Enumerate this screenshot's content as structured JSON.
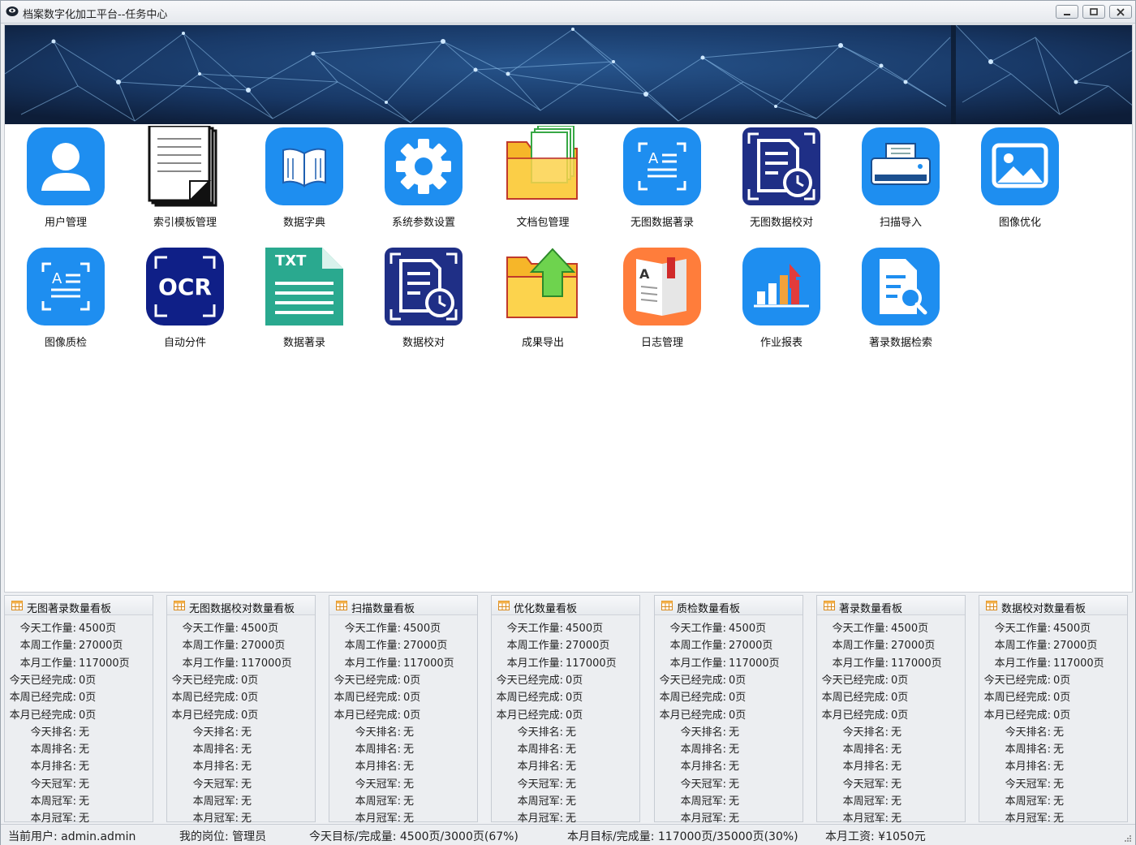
{
  "window": {
    "title": "档案数字化加工平台--任务中心"
  },
  "modules": [
    {
      "label": "用户管理",
      "icon": "user-icon"
    },
    {
      "label": "索引模板管理",
      "icon": "document-stack-icon"
    },
    {
      "label": "数据字典",
      "icon": "book-icon"
    },
    {
      "label": "系统参数设置",
      "icon": "gear-icon"
    },
    {
      "label": "文档包管理",
      "icon": "folder-documents-icon"
    },
    {
      "label": "无图数据著录",
      "icon": "text-scan-icon"
    },
    {
      "label": "无图数据校对",
      "icon": "document-clock-icon"
    },
    {
      "label": "扫描导入",
      "icon": "scanner-icon"
    },
    {
      "label": "图像优化",
      "icon": "image-icon"
    },
    {
      "label": "图像质检",
      "icon": "text-scan-icon"
    },
    {
      "label": "自动分件",
      "icon": "ocr-icon"
    },
    {
      "label": "数据著录",
      "icon": "txt-file-icon"
    },
    {
      "label": "数据校对",
      "icon": "document-clock-icon"
    },
    {
      "label": "成果导出",
      "icon": "folder-export-icon"
    },
    {
      "label": "日志管理",
      "icon": "log-book-icon"
    },
    {
      "label": "作业报表",
      "icon": "bar-chart-icon"
    },
    {
      "label": "著录数据检索",
      "icon": "document-search-icon"
    }
  ],
  "boards": [
    {
      "title": "无图著录数量看板",
      "rows": [
        {
          "k": "今天工作量:",
          "v": "4500页"
        },
        {
          "k": "本周工作量:",
          "v": "27000页"
        },
        {
          "k": "本月工作量:",
          "v": "117000页"
        },
        {
          "k": "今天已经完成:",
          "v": "0页"
        },
        {
          "k": "本周已经完成:",
          "v": "0页"
        },
        {
          "k": "本月已经完成:",
          "v": "0页"
        },
        {
          "k": "今天排名:",
          "v": "无"
        },
        {
          "k": "本周排名:",
          "v": "无"
        },
        {
          "k": "本月排名:",
          "v": "无"
        },
        {
          "k": "今天冠军:",
          "v": "无"
        },
        {
          "k": "本周冠军:",
          "v": "无"
        },
        {
          "k": "本月冠军:",
          "v": "无"
        }
      ]
    },
    {
      "title": "无图数据校对数量看板",
      "rows": [
        {
          "k": "今天工作量:",
          "v": "4500页"
        },
        {
          "k": "本周工作量:",
          "v": "27000页"
        },
        {
          "k": "本月工作量:",
          "v": "117000页"
        },
        {
          "k": "今天已经完成:",
          "v": "0页"
        },
        {
          "k": "本周已经完成:",
          "v": "0页"
        },
        {
          "k": "本月已经完成:",
          "v": "0页"
        },
        {
          "k": "今天排名:",
          "v": "无"
        },
        {
          "k": "本周排名:",
          "v": "无"
        },
        {
          "k": "本月排名:",
          "v": "无"
        },
        {
          "k": "今天冠军:",
          "v": "无"
        },
        {
          "k": "本周冠军:",
          "v": "无"
        },
        {
          "k": "本月冠军:",
          "v": "无"
        }
      ]
    },
    {
      "title": "扫描数量看板",
      "rows": [
        {
          "k": "今天工作量:",
          "v": "4500页"
        },
        {
          "k": "本周工作量:",
          "v": "27000页"
        },
        {
          "k": "本月工作量:",
          "v": "117000页"
        },
        {
          "k": "今天已经完成:",
          "v": "0页"
        },
        {
          "k": "本周已经完成:",
          "v": "0页"
        },
        {
          "k": "本月已经完成:",
          "v": "0页"
        },
        {
          "k": "今天排名:",
          "v": "无"
        },
        {
          "k": "本周排名:",
          "v": "无"
        },
        {
          "k": "本月排名:",
          "v": "无"
        },
        {
          "k": "今天冠军:",
          "v": "无"
        },
        {
          "k": "本周冠军:",
          "v": "无"
        },
        {
          "k": "本月冠军:",
          "v": "无"
        }
      ]
    },
    {
      "title": "优化数量看板",
      "rows": [
        {
          "k": "今天工作量:",
          "v": "4500页"
        },
        {
          "k": "本周工作量:",
          "v": "27000页"
        },
        {
          "k": "本月工作量:",
          "v": "117000页"
        },
        {
          "k": "今天已经完成:",
          "v": "0页"
        },
        {
          "k": "本周已经完成:",
          "v": "0页"
        },
        {
          "k": "本月已经完成:",
          "v": "0页"
        },
        {
          "k": "今天排名:",
          "v": "无"
        },
        {
          "k": "本周排名:",
          "v": "无"
        },
        {
          "k": "本月排名:",
          "v": "无"
        },
        {
          "k": "今天冠军:",
          "v": "无"
        },
        {
          "k": "本周冠军:",
          "v": "无"
        },
        {
          "k": "本月冠军:",
          "v": "无"
        }
      ]
    },
    {
      "title": "质检数量看板",
      "rows": [
        {
          "k": "今天工作量:",
          "v": "4500页"
        },
        {
          "k": "本周工作量:",
          "v": "27000页"
        },
        {
          "k": "本月工作量:",
          "v": "117000页"
        },
        {
          "k": "今天已经完成:",
          "v": "0页"
        },
        {
          "k": "本周已经完成:",
          "v": "0页"
        },
        {
          "k": "本月已经完成:",
          "v": "0页"
        },
        {
          "k": "今天排名:",
          "v": "无"
        },
        {
          "k": "本周排名:",
          "v": "无"
        },
        {
          "k": "本月排名:",
          "v": "无"
        },
        {
          "k": "今天冠军:",
          "v": "无"
        },
        {
          "k": "本周冠军:",
          "v": "无"
        },
        {
          "k": "本月冠军:",
          "v": "无"
        }
      ]
    },
    {
      "title": "著录数量看板",
      "rows": [
        {
          "k": "今天工作量:",
          "v": "4500页"
        },
        {
          "k": "本周工作量:",
          "v": "27000页"
        },
        {
          "k": "本月工作量:",
          "v": "117000页"
        },
        {
          "k": "今天已经完成:",
          "v": "0页"
        },
        {
          "k": "本周已经完成:",
          "v": "0页"
        },
        {
          "k": "本月已经完成:",
          "v": "0页"
        },
        {
          "k": "今天排名:",
          "v": "无"
        },
        {
          "k": "本周排名:",
          "v": "无"
        },
        {
          "k": "本月排名:",
          "v": "无"
        },
        {
          "k": "今天冠军:",
          "v": "无"
        },
        {
          "k": "本周冠军:",
          "v": "无"
        },
        {
          "k": "本月冠军:",
          "v": "无"
        }
      ]
    },
    {
      "title": "数据校对数量看板",
      "rows": [
        {
          "k": "今天工作量:",
          "v": "4500页"
        },
        {
          "k": "本周工作量:",
          "v": "27000页"
        },
        {
          "k": "本月工作量:",
          "v": "117000页"
        },
        {
          "k": "今天已经完成:",
          "v": "0页"
        },
        {
          "k": "本周已经完成:",
          "v": "0页"
        },
        {
          "k": "本月已经完成:",
          "v": "0页"
        },
        {
          "k": "今天排名:",
          "v": "无"
        },
        {
          "k": "本周排名:",
          "v": "无"
        },
        {
          "k": "本月排名:",
          "v": "无"
        },
        {
          "k": "今天冠军:",
          "v": "无"
        },
        {
          "k": "本周冠军:",
          "v": "无"
        },
        {
          "k": "本月冠军:",
          "v": "无"
        }
      ]
    }
  ],
  "status": {
    "user": "当前用户: admin.admin",
    "role": "我的岗位: 管理员",
    "today": "今天目标/完成量: 4500页/3000页(67%)",
    "month": "本月目标/完成量: 117000页/35000页(30%)",
    "salary": "本月工资: ¥1050元"
  },
  "colors": {
    "blue_tile": "#1e8ef0",
    "navy_tile": "#1f2f86",
    "teal_tile": "#2aa98f",
    "orange_tile": "#ff7d3b",
    "banner": "#142a4c"
  }
}
